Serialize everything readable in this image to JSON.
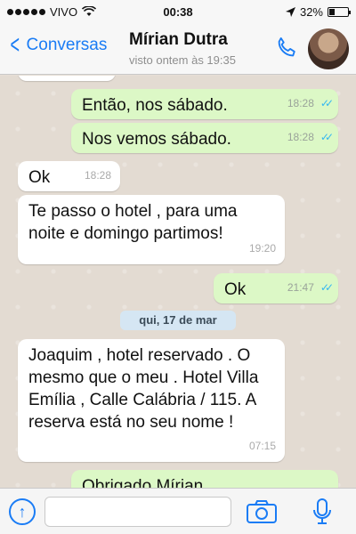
{
  "status_bar": {
    "carrier": "VIVO",
    "time": "00:38",
    "battery_percent": "32%",
    "battery_level": 0.32
  },
  "nav": {
    "back_label": "Conversas",
    "contact_name": "Mírian Dutra",
    "contact_status": "visto ontem às 19:35"
  },
  "messages": [
    {
      "direction": "out",
      "text": "Então, nos sábado.",
      "time": "18:28",
      "ticks": "✓✓"
    },
    {
      "direction": "out",
      "text": "Nos vemos sábado.",
      "time": "18:28",
      "ticks": "✓✓"
    },
    {
      "direction": "in",
      "text": "Ok",
      "time": "18:28"
    },
    {
      "direction": "in",
      "text": "Te passo o hotel , para uma noite e domingo partimos!",
      "time": "19:20"
    },
    {
      "direction": "out",
      "text": "Ok",
      "time": "21:47",
      "ticks": "✓✓"
    },
    {
      "direction": "in",
      "text": "Joaquim , hotel reservado . O mesmo que o meu . Hotel Villa Emília , Calle Calábria / 115. A reserva está no seu nome !",
      "time": "07:15"
    },
    {
      "direction": "out",
      "text": "Obrigado  Mírian",
      "time": "",
      "ticks": ""
    }
  ],
  "date_separator": "qui, 17 de mar",
  "input": {
    "value": "",
    "placeholder": ""
  },
  "colors": {
    "accent": "#1a7cf5",
    "outgoing_bubble": "#dcf8c6",
    "incoming_bubble": "#ffffff",
    "read_ticks": "#34b7f1"
  },
  "icons": [
    "chevron-left-icon",
    "phone-icon",
    "share-icon",
    "camera-icon",
    "microphone-icon",
    "location-arrow-icon",
    "wifi-icon"
  ]
}
